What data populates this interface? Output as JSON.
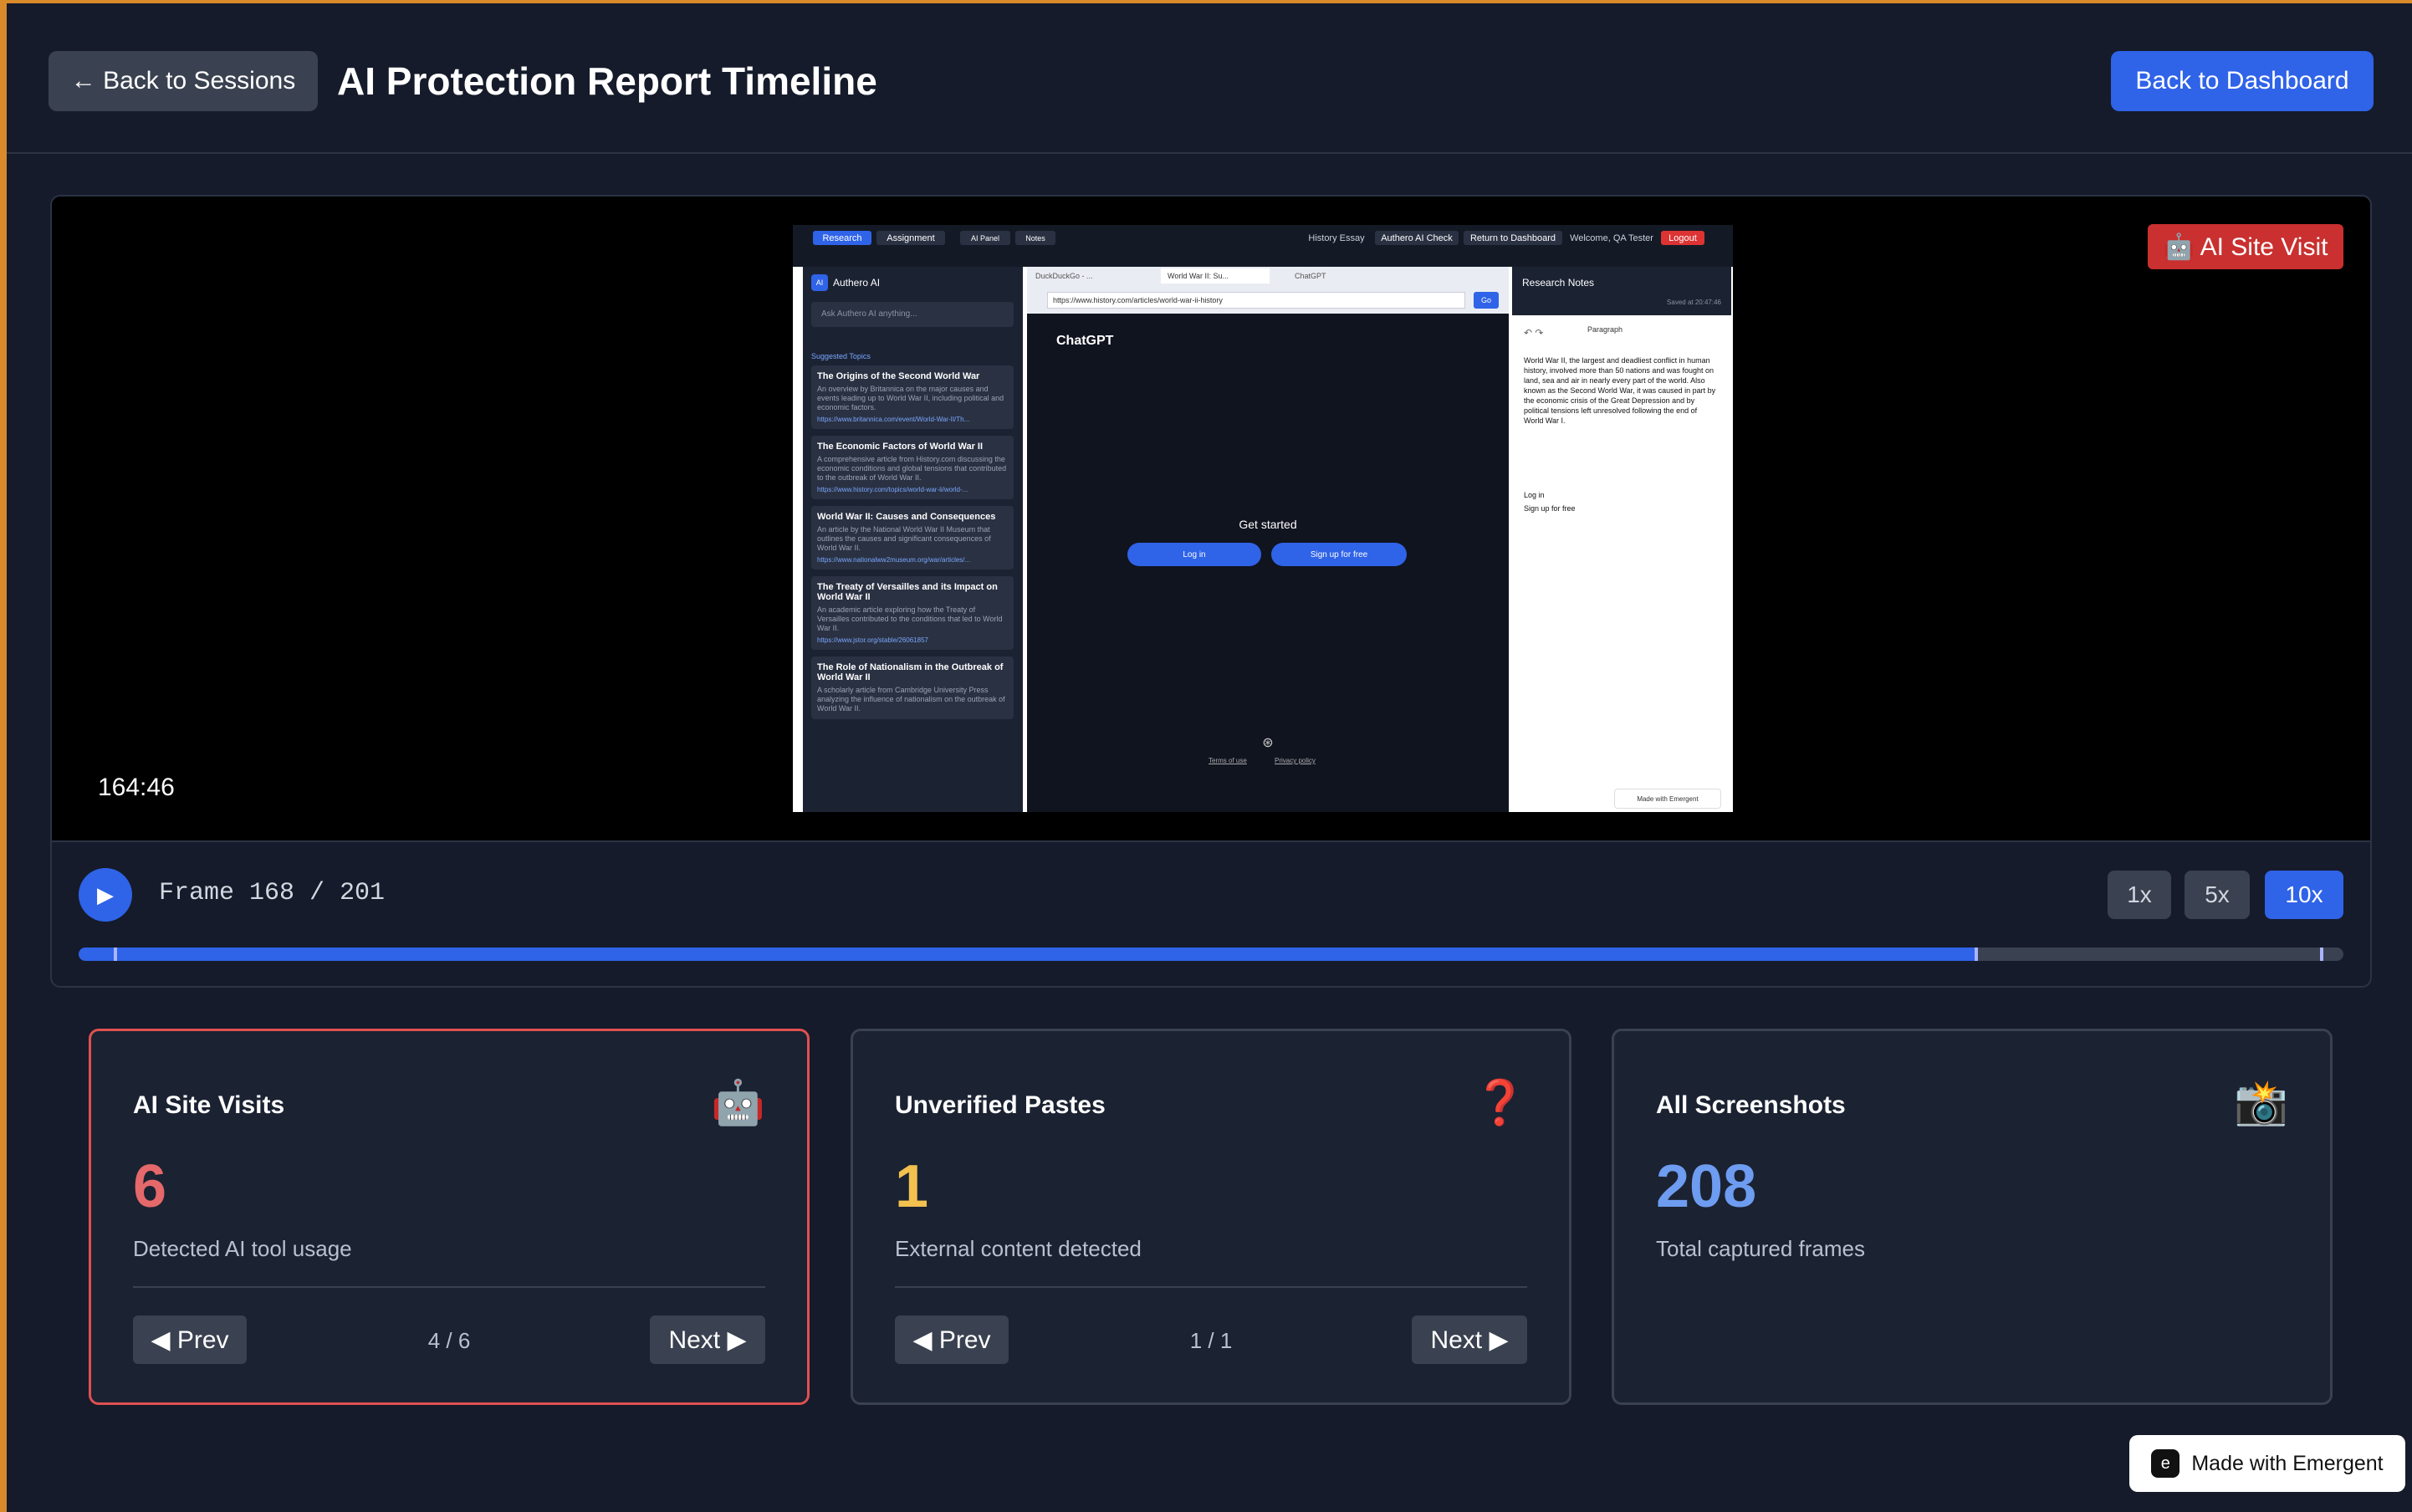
{
  "header": {
    "back_sessions": "← Back to Sessions",
    "title": "AI Protection Report Timeline",
    "back_dashboard": "Back to Dashboard"
  },
  "player": {
    "timestamp": "164:46",
    "badge_icon": "robot-icon",
    "badge_label": "🤖 AI Site Visit",
    "frame_text": "Frame 168 / 201",
    "progress_fraction": 0.8378,
    "speeds": [
      "1x",
      "5x",
      "10x"
    ],
    "active_speed": "10x"
  },
  "cards": [
    {
      "title": "AI Site Visits",
      "icon": "🤖",
      "value": "6",
      "value_color": "#e5686a",
      "subtitle": "Detected AI tool usage",
      "prev": "◀ Prev",
      "next": "Next ▶",
      "count": "4 / 6"
    },
    {
      "title": "Unverified Pastes",
      "icon": "❓",
      "value": "1",
      "value_color": "#f2c14e",
      "subtitle": "External content detected",
      "prev": "◀ Prev",
      "next": "Next ▶",
      "count": "1 / 1"
    },
    {
      "title": "All Screenshots",
      "icon": "📸",
      "value": "208",
      "value_color": "#6d9cf0",
      "subtitle": "Total captured frames"
    }
  ],
  "made_with": "Made with Emergent",
  "screenshot": {
    "tabs": [
      "Research",
      "Assignment",
      "AI Panel",
      "Notes"
    ],
    "top_right": [
      "History Essay",
      "Authero AI Check",
      "Return to Dashboard",
      "Welcome, QA Tester",
      "Logout"
    ],
    "ai_panel_title": "Authero AI",
    "ai_input_placeholder": "Ask Authero AI anything...",
    "suggested": "Suggested Topics",
    "topics": [
      {
        "title": "The Origins of the Second World War",
        "desc": "An overview by Britannica on the major causes and events leading up to World War II, including political and economic factors.",
        "link": "https://www.britannica.com/event/World-War-II/Th..."
      },
      {
        "title": "The Economic Factors of World War II",
        "desc": "A comprehensive article from History.com discussing the economic conditions and global tensions that contributed to the outbreak of World War II.",
        "link": "https://www.history.com/topics/world-war-ii/world-..."
      },
      {
        "title": "World War II: Causes and Consequences",
        "desc": "An article by the National World War II Museum that outlines the causes and significant consequences of World War II.",
        "link": "https://www.nationalww2museum.org/war/articles/..."
      },
      {
        "title": "The Treaty of Versailles and its Impact on World War II",
        "desc": "An academic article exploring how the Treaty of Versailles contributed to the conditions that led to World War II.",
        "link": "https://www.jstor.org/stable/26061857"
      },
      {
        "title": "The Role of Nationalism in the Outbreak of World War II",
        "desc": "A scholarly article from Cambridge University Press analyzing the influence of nationalism on the outbreak of World War II.",
        "link": ""
      }
    ],
    "browser_tabs": [
      "DuckDuckGo - ...",
      "World War II: Su...",
      "ChatGPT"
    ],
    "url": "https://www.history.com/articles/world-war-ii-history",
    "go": "Go",
    "chatgpt_title": "ChatGPT",
    "get_started": "Get started",
    "login": "Log in",
    "signup": "Sign up for free",
    "terms": "Terms of use",
    "privacy": "Privacy policy",
    "notes_title": "Research Notes",
    "saved": "Saved at 20:47:46",
    "paragraph": "Paragraph",
    "notes_text": "World War II, the largest and deadliest conflict in human history, involved more than 50 nations and was fought on land, sea and air in nearly every part of the world. Also known as the Second World War, it was caused in part by the economic crisis of the Great Depression and by political tensions left unresolved following the end of World War I.",
    "notes_login": "Log in",
    "notes_signup": "Sign up for free",
    "made_small": "Made with Emergent"
  }
}
